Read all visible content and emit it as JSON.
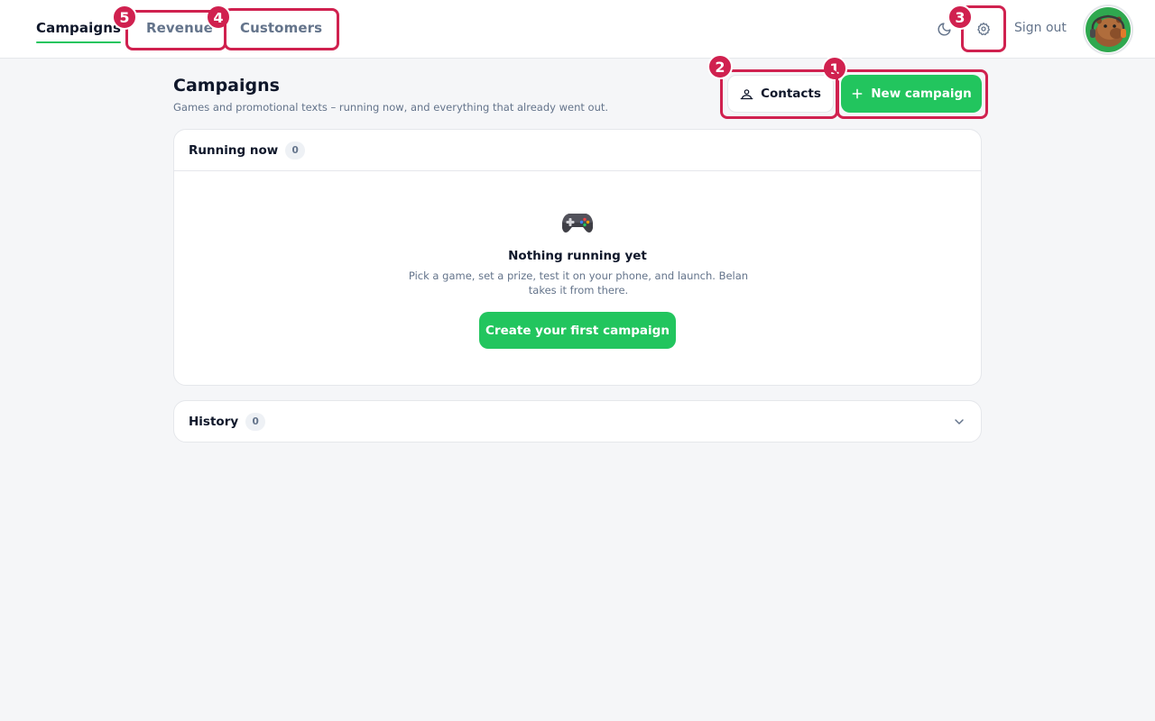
{
  "nav": {
    "tabs": [
      {
        "label": "Campaigns",
        "active": true
      },
      {
        "label": "Revenue",
        "active": false
      },
      {
        "label": "Customers",
        "active": false
      }
    ],
    "sign_out": "Sign out"
  },
  "page": {
    "title": "Campaigns",
    "subtitle": "Games and promotional texts – running now, and everything that already went out."
  },
  "actions": {
    "contacts": "Contacts",
    "new_campaign": "New campaign"
  },
  "running": {
    "title": "Running now",
    "count": "0",
    "empty_title": "Nothing running yet",
    "empty_desc": "Pick a game, set a prize, test it on your phone, and launch. Belan takes it from there.",
    "cta": "Create your first campaign"
  },
  "history": {
    "title": "History",
    "count": "0"
  },
  "annotations": [
    "1",
    "2",
    "3",
    "4",
    "5"
  ],
  "colors": {
    "accent": "#22c55e",
    "annotation": "#d0214f",
    "text": "#0f172a",
    "muted": "#64748b"
  },
  "icons": {
    "theme": "moon-icon",
    "settings": "gear-icon",
    "contacts": "users-icon",
    "add": "plus-icon",
    "empty": "gamepad-icon",
    "expand": "chevron-down-icon"
  }
}
